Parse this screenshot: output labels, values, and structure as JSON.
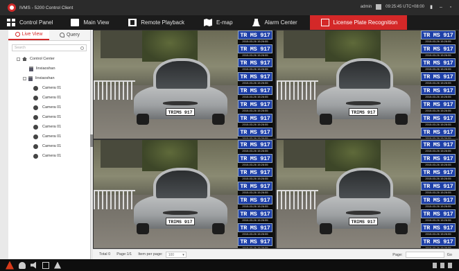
{
  "app": {
    "title": "IVMS - 5200 Control Client",
    "user": "admin",
    "clock": "09:25:45 UTC+08:00"
  },
  "menu": [
    {
      "label": "Control Panel",
      "icon": "grid-icon"
    },
    {
      "label": "Main View",
      "icon": "camera-icon"
    },
    {
      "label": "Remote Playback",
      "icon": "film-icon"
    },
    {
      "label": "E-map",
      "icon": "map-icon"
    },
    {
      "label": "Alarm Center",
      "icon": "alarm-icon"
    },
    {
      "label": "License Plate Recognition",
      "icon": "lpr-icon",
      "active": true
    }
  ],
  "left_panel": {
    "tabs": [
      {
        "label": "Live View",
        "active": true
      },
      {
        "label": "Query",
        "active": false
      }
    ],
    "search_placeholder": "Search",
    "tree": {
      "root": "Control Center",
      "groups": [
        {
          "label": "linxiaoshan"
        },
        {
          "label": "linxiaoshan"
        }
      ],
      "cameras": [
        "Camera 01",
        "Camera 01",
        "Camera 01",
        "Camera 01",
        "Camera 01",
        "Camera 01",
        "Camera 01",
        "Camera 01"
      ]
    }
  },
  "video": {
    "plate": "TRIMS 917",
    "plate_strip": "TR MS 917",
    "timestamp": "2015-03-26 15:26:55"
  },
  "status": {
    "total": "Total 0",
    "page": "Page:1/1",
    "items_label": "Item per page:",
    "items_value": "100",
    "page_label": "Page:",
    "go": "Go"
  },
  "colors": {
    "accent": "#d42828",
    "plate_blue": "#1e40a8"
  }
}
